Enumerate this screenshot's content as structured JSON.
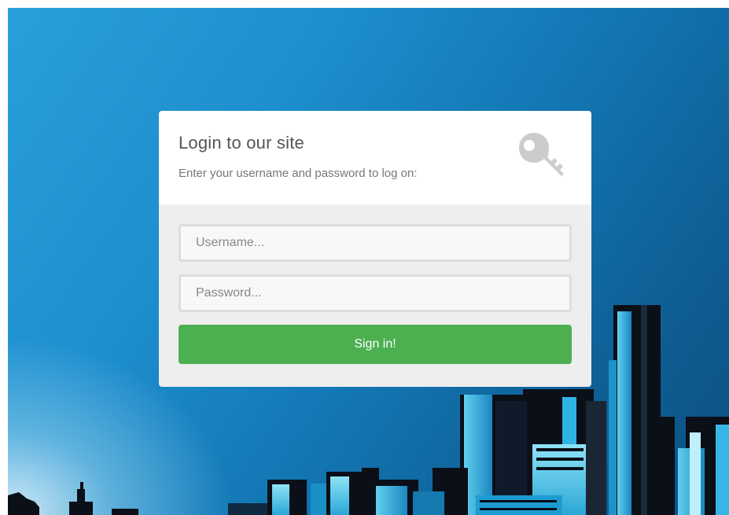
{
  "login": {
    "title": "Login to our site",
    "subtitle": "Enter your username and password to log on:",
    "username_placeholder": "Username...",
    "username_value": "",
    "password_placeholder": "Password...",
    "password_value": "",
    "signin_label": "Sign in!",
    "icon": "key-icon"
  },
  "colors": {
    "background_gradient_start": "#2a9fd8",
    "background_gradient_end": "#0b4f82",
    "card_header_bg": "#ffffff",
    "card_body_bg": "#eeeeee",
    "button_bg": "#4caf50",
    "button_text": "#ffffff",
    "key_icon": "#cccccc"
  }
}
